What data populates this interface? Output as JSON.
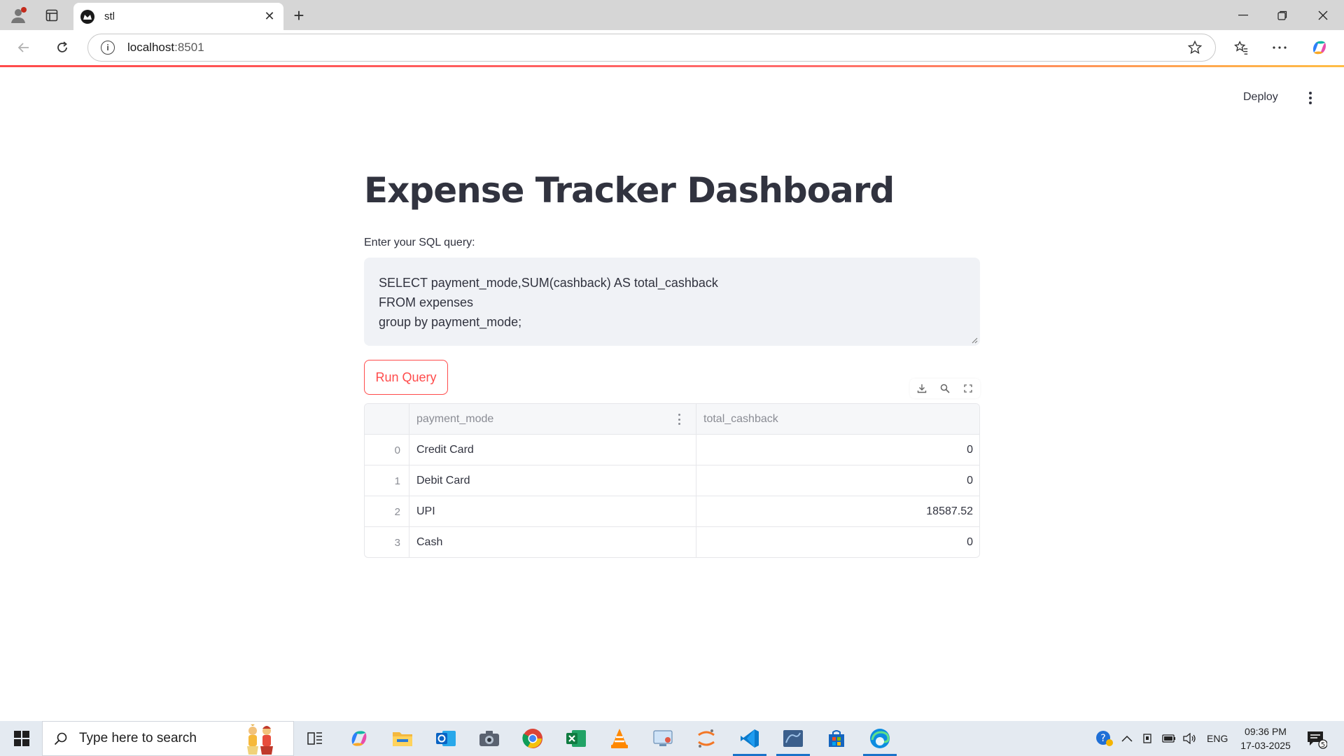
{
  "browser": {
    "tab_title": "stl",
    "url_host": "localhost",
    "url_port": ":8501"
  },
  "app": {
    "deploy_label": "Deploy",
    "title": "Expense Tracker Dashboard",
    "query_label": "Enter your SQL query:",
    "query_lines": [
      "SELECT payment_mode,SUM(cashback) AS total_cashback",
      "FROM expenses",
      "group by payment_mode;"
    ],
    "run_button": "Run Query",
    "accent_color": "#ff4b4b"
  },
  "table": {
    "columns": [
      "payment_mode",
      "total_cashback"
    ],
    "rows": [
      {
        "index": "0",
        "payment_mode": "Credit Card",
        "total_cashback": "0"
      },
      {
        "index": "1",
        "payment_mode": "Debit Card",
        "total_cashback": "0"
      },
      {
        "index": "2",
        "payment_mode": "UPI",
        "total_cashback": "18587.52"
      },
      {
        "index": "3",
        "payment_mode": "Cash",
        "total_cashback": "0"
      }
    ]
  },
  "taskbar": {
    "search_placeholder": "Type here to search",
    "language": "ENG",
    "time": "09:36 PM",
    "date": "17-03-2025",
    "notification_count": "5",
    "pinned_icons": [
      "task-view-icon",
      "copilot-icon",
      "file-explorer-icon",
      "outlook-icon",
      "camera-icon",
      "chrome-icon",
      "excel-icon",
      "vlc-icon",
      "remote-desktop-icon",
      "jupyter-icon",
      "vscode-icon",
      "mysql-workbench-icon",
      "microsoft-store-icon",
      "edge-icon"
    ]
  }
}
